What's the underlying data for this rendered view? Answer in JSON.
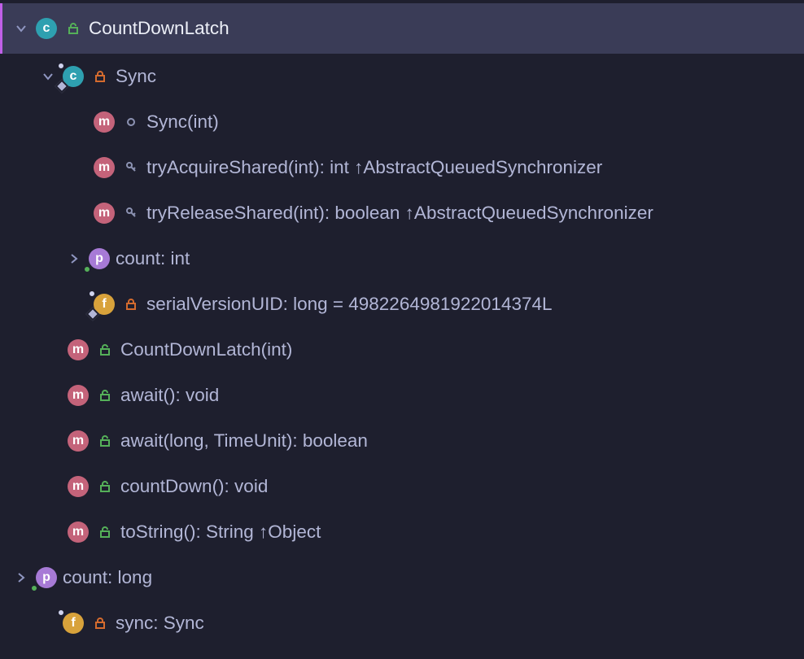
{
  "root": {
    "name": "CountDownLatch"
  },
  "sync": {
    "name": "Sync",
    "ctor": "Sync(int)",
    "tryAcquire": "tryAcquireShared(int): int ↑AbstractQueuedSynchronizer",
    "tryRelease": "tryReleaseShared(int): boolean ↑AbstractQueuedSynchronizer",
    "countProp": "count: int",
    "serialUID": "serialVersionUID: long = 4982264981922014374L"
  },
  "members": {
    "ctor": "CountDownLatch(int)",
    "await0": "await(): void",
    "await1": "await(long, TimeUnit): boolean",
    "countDown": "countDown(): void",
    "toString": "toString(): String ↑Object",
    "countProp": "count: long",
    "syncField": "sync: Sync"
  },
  "glyphs": {
    "c": "c",
    "m": "m",
    "p": "p",
    "f": "f"
  }
}
